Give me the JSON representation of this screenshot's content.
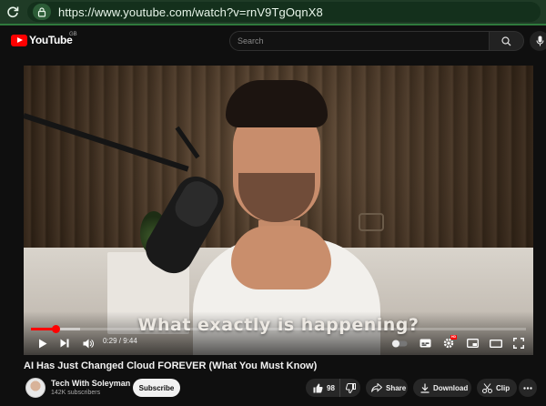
{
  "browser": {
    "url": "https://www.youtube.com/watch?v=rnV9TgOqnX8",
    "theme_color": "#1f3b26"
  },
  "header": {
    "logo_text": "YouTube",
    "country_code": "GB",
    "search_placeholder": "Search",
    "brand_color": "#ff0000"
  },
  "player": {
    "caption": "What exactly is happening?",
    "current_time": "0:29",
    "duration": "9:44",
    "time_display": "0:29 / 9:44",
    "progress_fraction": 0.05,
    "buffered_fraction": 0.1,
    "settings_badge": "HD"
  },
  "video": {
    "title": "AI Has Just Changed Cloud FOREVER (What You Must Know)"
  },
  "channel": {
    "name": "Tech With Soleyman",
    "subscribers": "142K subscribers",
    "subscribe_label": "Subscribe"
  },
  "actions": {
    "like_count": "98",
    "share_label": "Share",
    "download_label": "Download",
    "clip_label": "Clip"
  }
}
